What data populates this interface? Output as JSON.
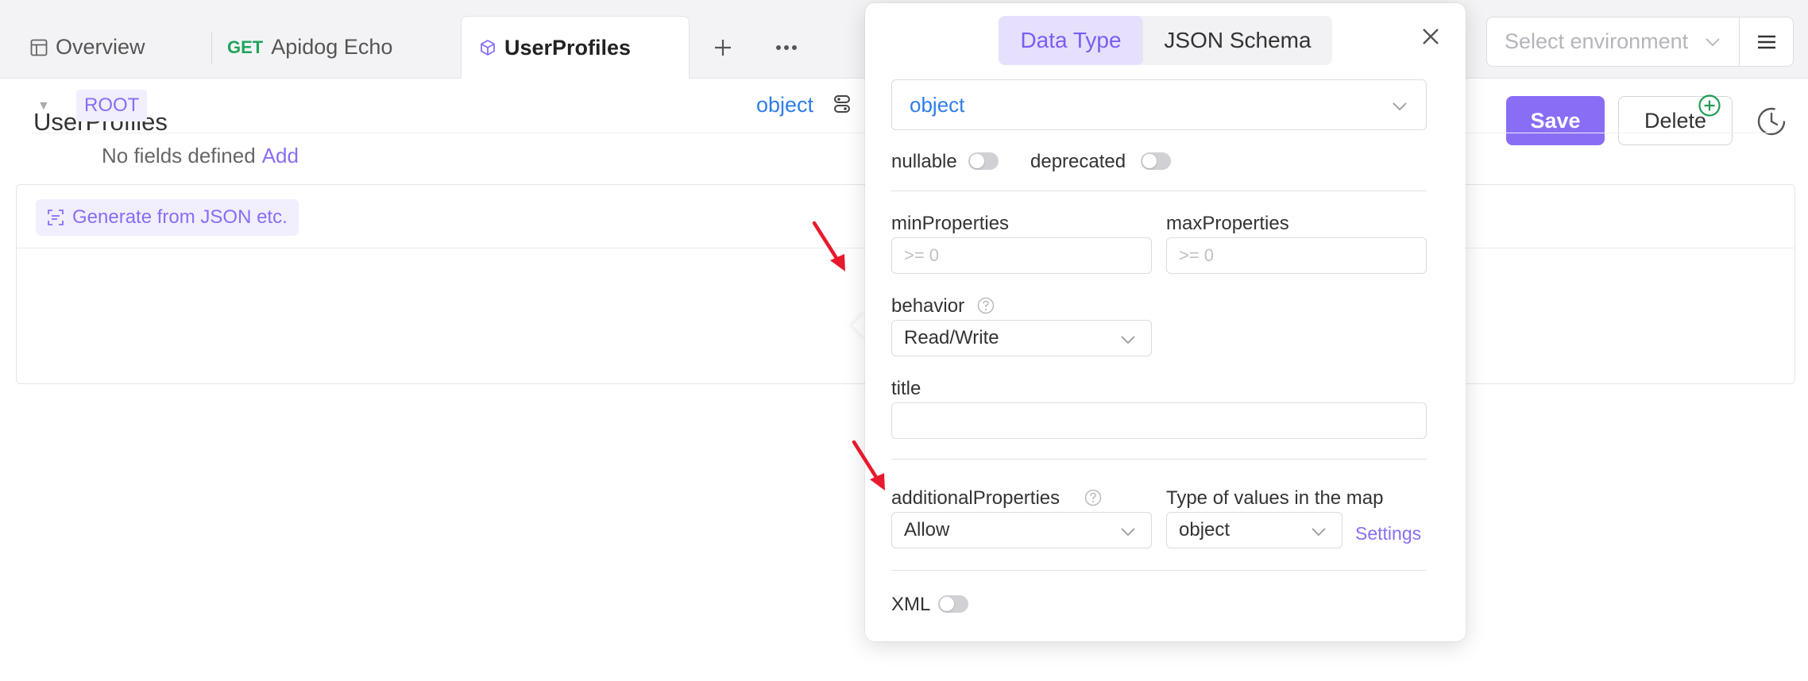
{
  "tabs": {
    "overview": "Overview",
    "echo_method": "GET",
    "echo_label": "Apidog Echo",
    "active": "UserProfiles"
  },
  "environment": {
    "placeholder": "Select environment"
  },
  "header": {
    "title": "UserProfiles",
    "save": "Save",
    "delete": "Delete"
  },
  "schema": {
    "generate": "Generate from JSON etc.",
    "root": "ROOT",
    "root_type": "object",
    "empty": "No fields defined",
    "add": "Add"
  },
  "popover": {
    "tabs": {
      "data_type": "Data Type",
      "json_schema": "JSON Schema"
    },
    "type_value": "object",
    "nullable": "nullable",
    "deprecated": "deprecated",
    "min_properties": {
      "label": "minProperties",
      "placeholder": ">= 0"
    },
    "max_properties": {
      "label": "maxProperties",
      "placeholder": ">= 0"
    },
    "behavior": {
      "label": "behavior",
      "value": "Read/Write"
    },
    "title": {
      "label": "title",
      "value": ""
    },
    "additional_properties": {
      "label": "additionalProperties",
      "value": "Allow"
    },
    "map_values": {
      "label": "Type of values in the map",
      "value": "object"
    },
    "settings": "Settings",
    "xml": "XML"
  },
  "colors": {
    "accent": "#8a6df5",
    "link_blue": "#2f7de8",
    "method_green": "#1fa45a",
    "annotation_red": "#e8192c"
  }
}
